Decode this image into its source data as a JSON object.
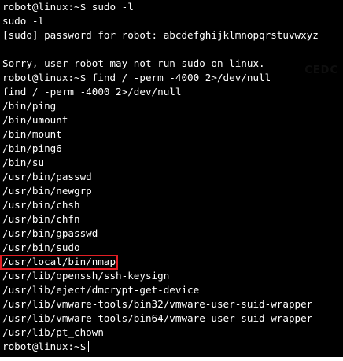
{
  "terminal": {
    "background_color": "#000000",
    "text_color": "#ffffff",
    "highlight_color": "#e31e24",
    "ghost_text": "CEDC",
    "lines": [
      "robot@linux:~$ sudo -l",
      "sudo -l",
      "[sudo] password for robot: abcdefghijklmnopqrstuvwxyz",
      "",
      "Sorry, user robot may not run sudo on linux.",
      "robot@linux:~$ find / -perm -4000 2>/dev/null",
      "find / -perm -4000 2>/dev/null",
      "/bin/ping",
      "/bin/umount",
      "/bin/mount",
      "/bin/ping6",
      "/bin/su",
      "/usr/bin/passwd",
      "/usr/bin/newgrp",
      "/usr/bin/chsh",
      "/usr/bin/chfn",
      "/usr/bin/gpasswd",
      "/usr/bin/sudo",
      "/usr/local/bin/nmap",
      "/usr/lib/openssh/ssh-keysign",
      "/usr/lib/eject/dmcrypt-get-device",
      "/usr/lib/vmware-tools/bin32/vmware-user-suid-wrapper",
      "/usr/lib/vmware-tools/bin64/vmware-user-suid-wrapper",
      "/usr/lib/pt_chown",
      "robot@linux:~$"
    ]
  }
}
